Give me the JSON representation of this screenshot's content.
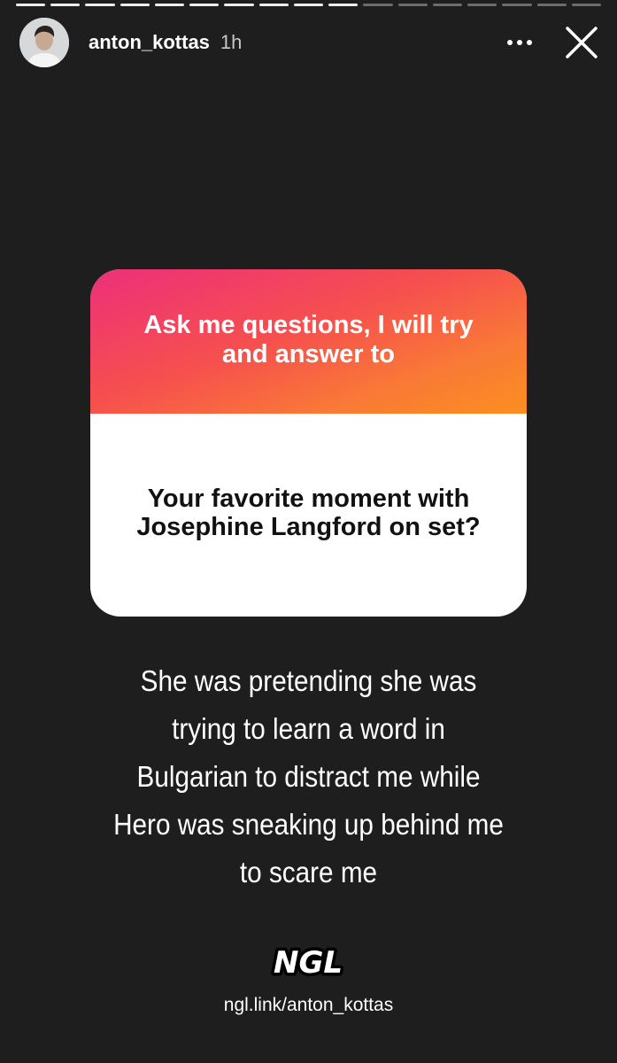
{
  "story": {
    "progress": {
      "total_segments": 17,
      "completed_segments": 10
    },
    "header": {
      "username": "anton_kottas",
      "time_ago": "1h",
      "avatar": "profile-photo",
      "more_icon": "more-horizontal-icon",
      "close_icon": "close-icon"
    },
    "card": {
      "prompt": "Ask me questions, I will try and answer to",
      "question": "Your favorite moment with Josephine Langford on set?",
      "gradient_colors": [
        "#ec2f7a",
        "#f6504e",
        "#f97936",
        "#fb8f1f"
      ]
    },
    "answer_lines": [
      "She was pretending she was",
      "trying to learn a word in",
      "Bulgarian to distract me while",
      "Hero was sneaking up behind me",
      "to scare me"
    ],
    "footer": {
      "logo_text": "NGL",
      "link": "ngl.link/anton_kottas"
    }
  },
  "colors": {
    "background": "#1e1e1e",
    "text": "#ffffff",
    "question_text": "#111111"
  }
}
